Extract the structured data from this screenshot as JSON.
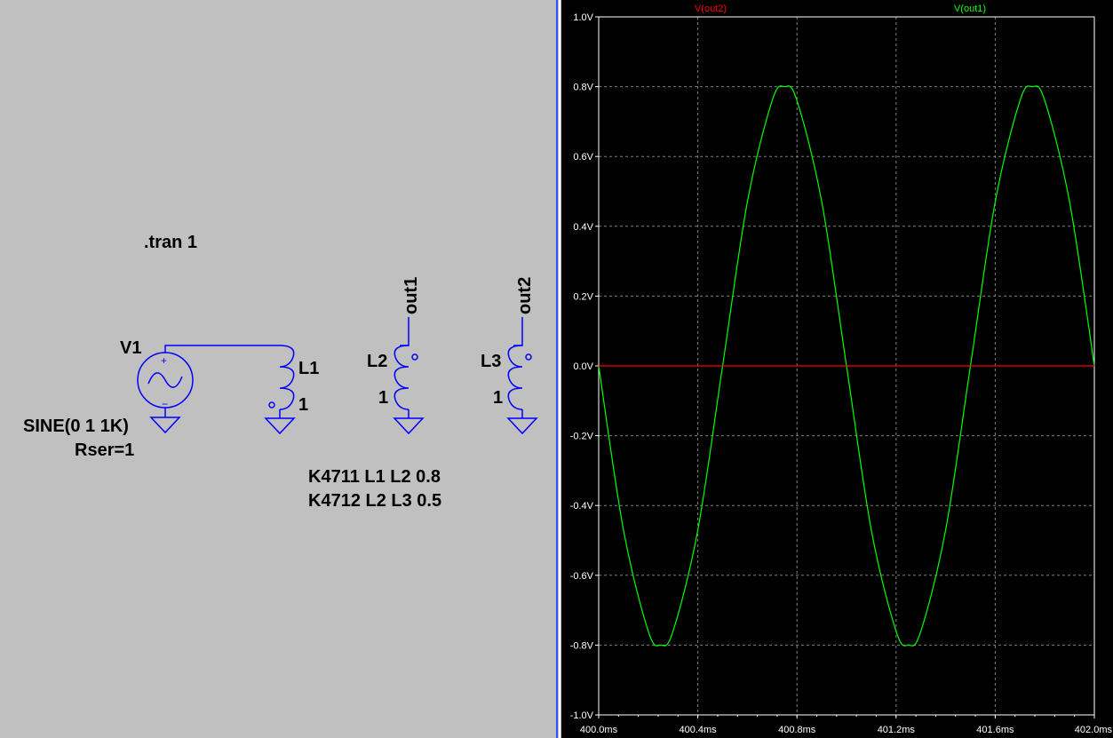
{
  "schematic": {
    "directive": ".tran 1",
    "source": {
      "name": "V1",
      "value": "SINE(0 1 1K)",
      "param": "Rser=1"
    },
    "inductors": [
      {
        "name": "L1",
        "value": "1"
      },
      {
        "name": "L2",
        "value": "1"
      },
      {
        "name": "L3",
        "value": "1"
      }
    ],
    "nets": {
      "out1": "out1",
      "out2": "out2"
    },
    "couplings": [
      "K4711 L1 L2 0.8",
      "K4712 L2 L3 0.5"
    ],
    "colors": {
      "wire": "#0000ff",
      "text": "#000000",
      "background": "#c0c0c0"
    }
  },
  "chart_data": {
    "type": "line",
    "title": "",
    "xlabel": "",
    "ylabel": "",
    "xlim": [
      400.0,
      402.0
    ],
    "ylim": [
      -1.0,
      1.0
    ],
    "grid": true,
    "x_ticks": [
      "400.0ms",
      "400.4ms",
      "400.8ms",
      "401.2ms",
      "401.6ms",
      "402.0ms"
    ],
    "y_ticks": [
      "1.0V",
      "0.8V",
      "0.6V",
      "0.4V",
      "0.2V",
      "0.0V",
      "-0.2V",
      "-0.4V",
      "-0.6V",
      "-0.8V",
      "-1.0V"
    ],
    "series": [
      {
        "name": "V(out2)",
        "color": "#ff0000",
        "x": [
          400.0,
          402.0
        ],
        "values": [
          0.0,
          0.0
        ]
      },
      {
        "name": "V(out1)",
        "color": "#00ff00",
        "x": [
          400.0,
          400.1,
          400.2,
          400.25,
          400.3,
          400.4,
          400.5,
          400.6,
          400.7,
          400.75,
          400.8,
          400.9,
          401.0,
          401.1,
          401.2,
          401.25,
          401.3,
          401.4,
          401.5,
          401.6,
          401.7,
          401.75,
          401.8,
          401.9,
          402.0
        ],
        "values": [
          0.0,
          -0.47,
          -0.76,
          -0.8,
          -0.76,
          -0.47,
          0.0,
          0.47,
          0.76,
          0.8,
          0.76,
          0.47,
          0.0,
          -0.47,
          -0.76,
          -0.8,
          -0.76,
          -0.47,
          0.0,
          0.47,
          0.76,
          0.8,
          0.76,
          0.47,
          0.0
        ]
      }
    ]
  }
}
